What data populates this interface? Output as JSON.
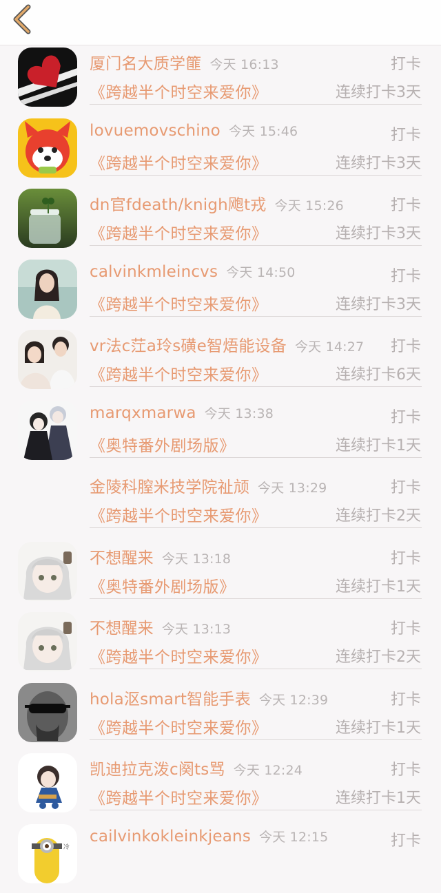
{
  "header": {
    "back_icon": "chevron-left-icon",
    "accent": "#e2a96a"
  },
  "entries": [
    {
      "name": "厦门名大质学篚",
      "time": "今天 16:13",
      "action": "打卡",
      "book": "《跨越半个时空来爱你》",
      "streak": "连续打卡3天",
      "avatar": "red-heart-on-black"
    },
    {
      "name": "lovuemovschino",
      "time": "今天 15:46",
      "action": "打卡",
      "book": "《跨越半个时空来爱你》",
      "streak": "连续打卡3天",
      "avatar": "red-fox-cartoon"
    },
    {
      "name": "dn官fdeath/knigh飑t戎",
      "time": "今天 15:26",
      "action": "打卡",
      "book": "《跨越半个时空来爱你》",
      "streak": "连续打卡3天",
      "avatar": "clover-in-jar"
    },
    {
      "name": "calvinkmleincvs",
      "time": "今天 14:50",
      "action": "打卡",
      "book": "《跨越半个时空来爱你》",
      "streak": "连续打卡3天",
      "avatar": "woman-portrait"
    },
    {
      "name": "vr法c茳a玲s磺e智焐能设备",
      "time": "今天 14:27",
      "action": "打卡",
      "book": "《跨越半个时空来爱你》",
      "streak": "连续打卡6天",
      "avatar": "couple-photo"
    },
    {
      "name": "marqxmarwa",
      "time": "今天 13:38",
      "action": "打卡",
      "book": "《奥特番外剧场版》",
      "streak": "连续打卡1天",
      "avatar": "anime-couple"
    },
    {
      "name": "金陵科膣米技学院祉颃",
      "time": "今天 13:29",
      "action": "打卡",
      "book": "《跨越半个时空来爱你》",
      "streak": "连续打卡2天",
      "avatar": "none"
    },
    {
      "name": "不想醒来",
      "time": "今天 13:18",
      "action": "打卡",
      "book": "《奥特番外剧场版》",
      "streak": "连续打卡1天",
      "avatar": "anime-girl-gray"
    },
    {
      "name": "不想醒来",
      "time": "今天 13:13",
      "action": "打卡",
      "book": "《跨越半个时空来爱你》",
      "streak": "连续打卡2天",
      "avatar": "anime-girl-gray"
    },
    {
      "name": "hola沤smart智能手表",
      "time": "今天 12:39",
      "action": "打卡",
      "book": "《跨越半个时空来爱你》",
      "streak": "连续打卡1天",
      "avatar": "man-sunglasses"
    },
    {
      "name": "凯迪拉克泼c阕ts骂",
      "time": "今天 12:24",
      "action": "打卡",
      "book": "《跨越半个时空来爱你》",
      "streak": "连续打卡1天",
      "avatar": "anime-chibi"
    },
    {
      "name": "cailvinkokleinkjeans",
      "time": "今天 12:15",
      "action": "打卡",
      "book": "",
      "streak": "",
      "avatar": "minion"
    }
  ]
}
